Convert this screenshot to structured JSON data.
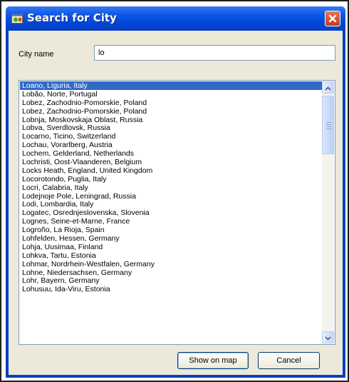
{
  "window": {
    "title": "Search for City"
  },
  "form": {
    "city_label": "City name",
    "city_value": "lo"
  },
  "list": {
    "selected_index": 0,
    "items": [
      "Loano, Liguria, Italy",
      "Lobão, Norte, Portugal",
      "Lobez, Zachodnio-Pomorskie, Poland",
      "Lobez, Zachodnio-Pomorskie, Poland",
      "Lobnja, Moskovskaja Oblast, Russia",
      "Lobva, Sverdlovsk, Russia",
      "Locarno, Ticino, Switzerland",
      "Lochau, Vorarlberg, Austria",
      "Lochem, Gelderland, Netherlands",
      "Lochristi, Oost-Vlaanderen, Belgium",
      "Locks Heath, England, United Kingdom",
      "Locorotondo, Puglia, Italy",
      "Locri, Calabria, Italy",
      "Lodejnoje Pole, Leningrad, Russia",
      "Lodi, Lombardia, Italy",
      "Logatec, Osrednjeslovenska, Slovenia",
      "Lognes, Seine-et-Marne, France",
      "Logroño, La Rioja, Spain",
      "Lohfelden, Hessen, Germany",
      "Lohja, Uusimaa, Finland",
      "Lohkva, Tartu, Estonia",
      "Lohmar, Nordrhein-Westfalen, Germany",
      "Lohne, Niedersachsen, Germany",
      "Lohr, Bayern, Germany",
      "Lohusuu, Ida-Viru, Estonia"
    ]
  },
  "buttons": {
    "show_on_map": "Show on map",
    "cancel": "Cancel"
  },
  "colors": {
    "titlebar": "#0046d5",
    "selection": "#316ac5",
    "dialog_bg": "#ece9d8"
  },
  "icons": {
    "app": "globe-window-icon",
    "close": "close-icon",
    "scroll_up": "chevron-up-icon",
    "scroll_down": "chevron-down-icon"
  }
}
